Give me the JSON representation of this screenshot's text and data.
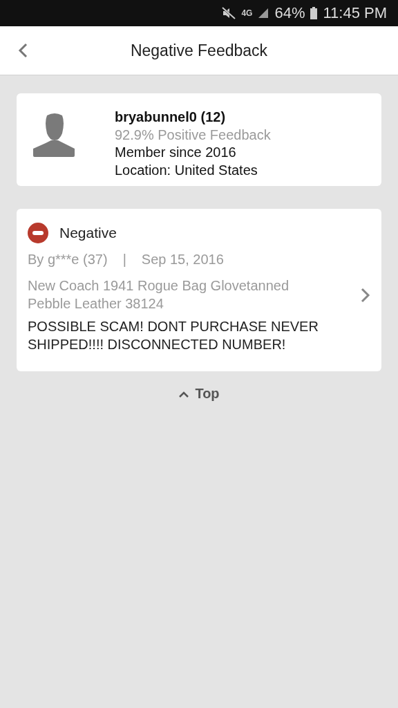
{
  "status_bar": {
    "network": "4G",
    "battery": "64%",
    "time": "11:45 PM"
  },
  "header": {
    "title": "Negative Feedback"
  },
  "user": {
    "name": "bryabunnel0",
    "score": "(12)",
    "positive": "92.9% Positive Feedback",
    "member_since": "Member since 2016",
    "location": "Location: United States"
  },
  "feedback": {
    "color": "#b83a2c",
    "rating_label": "Negative",
    "by": "By g***e (37)",
    "separator": "|",
    "date": "Sep 15, 2016",
    "item": "New Coach 1941 Rogue Bag Glovetanned Pebble Leather 38124",
    "comment": "POSSIBLE SCAM! DONT PURCHASE NEVER SHIPPED!!!! DISCONNECTED NUMBER!"
  },
  "top_link": "Top"
}
